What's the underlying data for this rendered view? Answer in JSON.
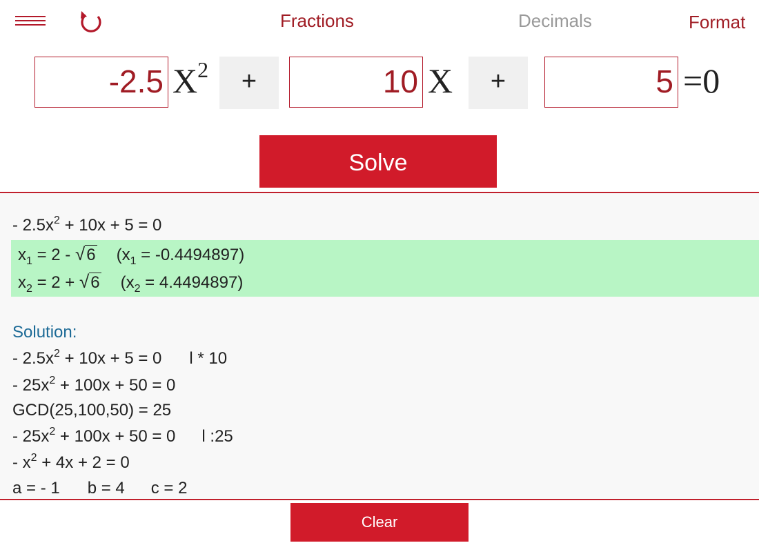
{
  "header": {
    "menu_icon": "hamburger-menu-icon",
    "undo_icon": "undo-arrow-icon",
    "tabs": [
      {
        "label": "Fractions",
        "color": "#a01c24"
      },
      {
        "label": "Decimals",
        "color": "#9a9a9a"
      },
      {
        "label": "Format",
        "color": "#a01c24"
      }
    ]
  },
  "equation": {
    "a": "-2.5",
    "b": "10",
    "c": "5",
    "var_x2": "X",
    "exp": "2",
    "var_x": "X",
    "op1": "+",
    "op2": "+",
    "rhs": "=0"
  },
  "solve_label": "Solve",
  "result": {
    "equation_line": {
      "pre": "- 2.5x",
      "exp": "2",
      "post": " + 10x + 5 = 0"
    },
    "x1": {
      "var": "x",
      "sub": "1",
      "pre": " = 2 - ",
      "radicand": "6",
      "approx_pre": "(x",
      "approx_sub": "1",
      "approx_post": " = -0.4494897)"
    },
    "x2": {
      "var": "x",
      "sub": "2",
      "pre": " = 2 + ",
      "radicand": "6",
      "approx_pre": "(x",
      "approx_sub": "2",
      "approx_post": " = 4.4494897)"
    },
    "solution_label": "Solution:",
    "steps": [
      {
        "pre": "- 2.5x",
        "exp": "2",
        "post": " + 10x + 5 = 0",
        "note": "l * 10"
      },
      {
        "pre": "- 25x",
        "exp": "2",
        "post": " + 100x + 50 = 0",
        "note": ""
      },
      {
        "text": "GCD(25,100,50) = 25"
      },
      {
        "pre": "- 25x",
        "exp": "2",
        "post": " + 100x + 50 = 0",
        "note": "l :25"
      },
      {
        "pre": "- x",
        "exp": "2",
        "post": " + 4x + 2 = 0",
        "note": ""
      },
      {
        "a": "a = - 1",
        "b": "b = 4",
        "c": "c = 2"
      }
    ]
  },
  "clear_label": "Clear",
  "colors": {
    "accent": "#d11b2a",
    "highlight": "#b8f5c5",
    "solution": "#1c6a96"
  }
}
